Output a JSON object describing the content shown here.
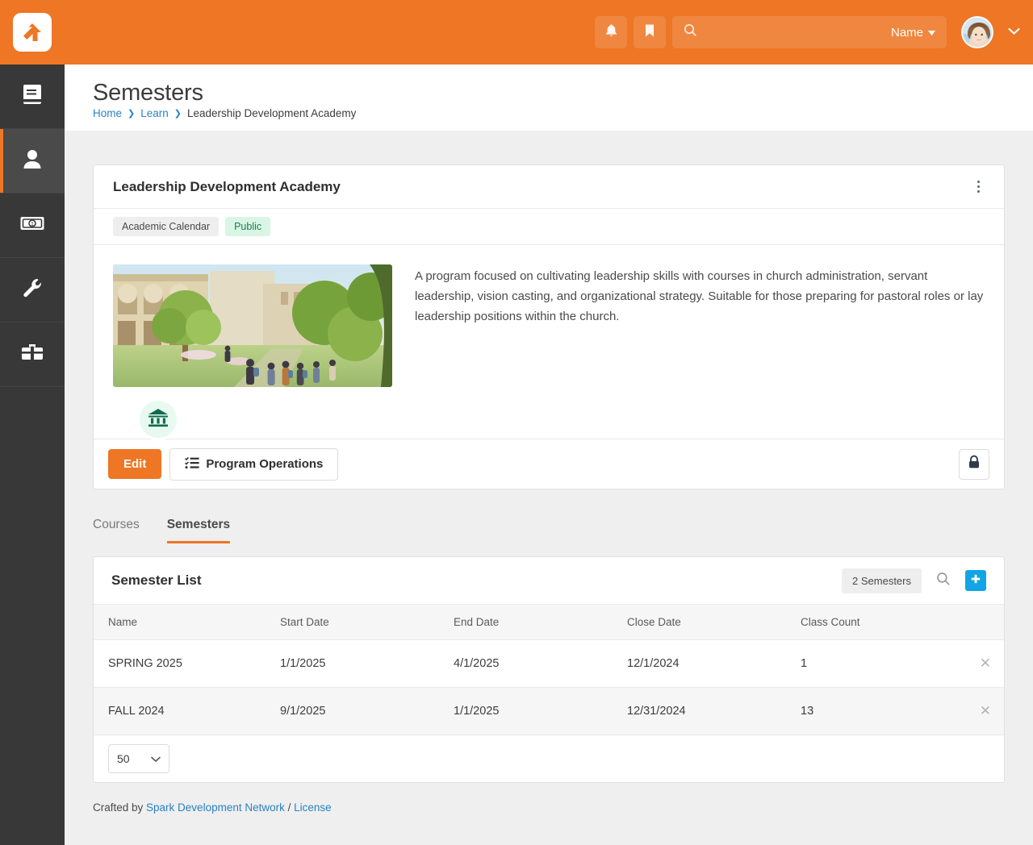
{
  "header": {
    "logo_icon": "rock-rms-logo-icon",
    "notifications_icon": "bell-icon",
    "bookmarks_icon": "bookmark-icon",
    "search_icon": "search-icon",
    "search_value": "",
    "search_placeholder": "",
    "search_scope_label": "Name",
    "scope_chevron_icon": "caret-down-icon",
    "avatar_icon": "user-avatar",
    "avatar_chevron_icon": "chevron-down-icon"
  },
  "sidebar": {
    "items": [
      {
        "icon": "book-icon",
        "name": "cms",
        "active": false
      },
      {
        "icon": "person-icon",
        "name": "people",
        "active": true
      },
      {
        "icon": "money-bill-icon",
        "name": "finance",
        "active": false
      },
      {
        "icon": "wrench-icon",
        "name": "admin-tools",
        "active": false
      },
      {
        "icon": "toolbox-icon",
        "name": "tools",
        "active": false
      }
    ]
  },
  "page": {
    "title": "Semesters",
    "breadcrumb": [
      {
        "label": "Home",
        "link": true
      },
      {
        "label": "Learn",
        "link": true
      },
      {
        "label": "Leadership Development Academy",
        "link": false
      }
    ],
    "breadcrumb_separator": "❯"
  },
  "program_card": {
    "title": "Leadership Development Academy",
    "kebab_icon": "ellipsis-vertical-icon",
    "badges": [
      {
        "label": "Academic Calendar",
        "style": "gray"
      },
      {
        "label": "Public",
        "style": "green"
      }
    ],
    "image_name": "campus-courtyard-illustration",
    "circle_icon": "university-bank-icon",
    "description": "A program focused on cultivating leadership skills with courses in church administration, servant leadership, vision casting, and organizational strategy. Suitable for those preparing for pastoral roles or lay leadership positions within the church.",
    "edit_label": "Edit",
    "operations_label": "Program Operations",
    "operations_icon": "task-list-icon",
    "lock_icon": "lock-icon"
  },
  "tabs": [
    {
      "label": "Courses",
      "active": false
    },
    {
      "label": "Semesters",
      "active": true
    }
  ],
  "semester_panel": {
    "title": "Semester List",
    "count_badge": "2 Semesters",
    "search_icon": "search-icon",
    "add_icon": "plus-icon",
    "columns": [
      "Name",
      "Start Date",
      "End Date",
      "Close Date",
      "Class Count"
    ],
    "rows": [
      {
        "name": "SPRING 2025",
        "start_date": "1/1/2025",
        "end_date": "4/1/2025",
        "close_date": "12/1/2024",
        "class_count": "1",
        "delete_icon": "close-icon"
      },
      {
        "name": "FALL 2024",
        "start_date": "9/1/2025",
        "end_date": "1/1/2025",
        "close_date": "12/31/2024",
        "class_count": "13",
        "delete_icon": "close-icon"
      }
    ],
    "page_size": "50",
    "page_size_chevron_icon": "chevron-down-icon"
  },
  "footer": {
    "prefix": "Crafted by ",
    "link1": "Spark Development Network",
    "divider": " / ",
    "link2": "License"
  },
  "colors": {
    "brand_orange": "#ee7624",
    "sidebar_dark": "#383838",
    "accent_blue": "#12a5e5",
    "link_blue": "#2a82c4",
    "badge_green_bg": "#d9f5e6",
    "badge_green_text": "#1f7a50"
  }
}
